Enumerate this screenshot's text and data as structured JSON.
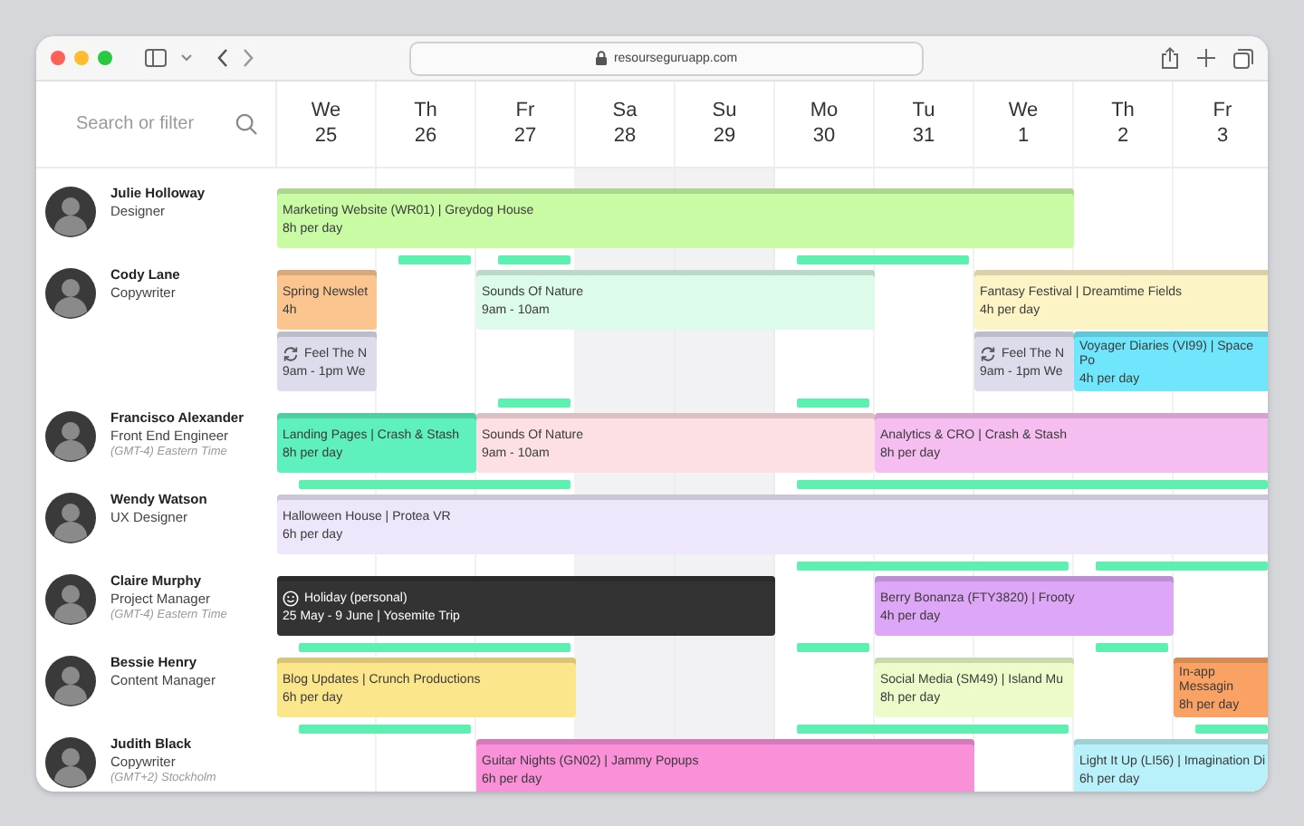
{
  "browser": {
    "url": "resourseguruapp.com"
  },
  "search": {
    "placeholder": "Search or filter"
  },
  "days": [
    {
      "weekday": "We",
      "date": "25",
      "weekend": false
    },
    {
      "weekday": "Th",
      "date": "26",
      "weekend": false
    },
    {
      "weekday": "Fr",
      "date": "27",
      "weekend": false
    },
    {
      "weekday": "Sa",
      "date": "28",
      "weekend": true
    },
    {
      "weekday": "Su",
      "date": "29",
      "weekend": true
    },
    {
      "weekday": "Mo",
      "date": "30",
      "weekend": false
    },
    {
      "weekday": "Tu",
      "date": "31",
      "weekend": false
    },
    {
      "weekday": "We",
      "date": "1",
      "weekend": false
    },
    {
      "weekday": "Th",
      "date": "2",
      "weekend": false
    },
    {
      "weekday": "Fr",
      "date": "3",
      "weekend": false
    }
  ],
  "people": [
    {
      "name": "Julie Holloway",
      "role": "Designer",
      "bookings": [
        {
          "kind": "project",
          "title": "Marketing Website (WR01) | Greydog House",
          "detail": "8h per day",
          "color": "#c9fba5"
        }
      ]
    },
    {
      "name": "Cody Lane",
      "role": "Copywriter",
      "bookings": [
        {
          "kind": "project",
          "title": "Spring Newslet",
          "detail": "4h",
          "color": "#fbc590"
        },
        {
          "kind": "project",
          "title": "Sounds Of Nature",
          "detail": "9am - 10am",
          "color": "#dcfbea"
        },
        {
          "kind": "project",
          "title": "Fantasy Festival | Dreamtime Fields",
          "detail": "4h per day",
          "color": "#fdf4c6"
        },
        {
          "kind": "recurring",
          "title": "Feel The N",
          "detail": "9am - 1pm We",
          "color": "#dcdcec"
        },
        {
          "kind": "recurring",
          "title": "Feel The N",
          "detail": "9am - 1pm We",
          "color": "#dcdcec"
        },
        {
          "kind": "project",
          "title": "Voyager Diaries (VI99) | Space Po",
          "detail": "4h per day",
          "color": "#6fe6fb"
        }
      ]
    },
    {
      "name": "Francisco Alexander",
      "role": "Front End Engineer",
      "timezone": "(GMT-4) Eastern Time",
      "bookings": [
        {
          "kind": "project",
          "title": "Landing Pages | Crash & Stash",
          "detail": "8h per day",
          "color": "#5ef0bd"
        },
        {
          "kind": "project",
          "title": "Sounds Of Nature",
          "detail": "9am - 10am",
          "color": "#fde0e3"
        },
        {
          "kind": "project",
          "title": "Analytics & CRO | Crash & Stash",
          "detail": "8h per day",
          "color": "#f6bdf1"
        }
      ]
    },
    {
      "name": "Wendy Watson",
      "role": "UX Designer",
      "bookings": [
        {
          "kind": "project",
          "title": "Halloween House | Protea VR",
          "detail": "6h per day",
          "color": "#eee6fb"
        }
      ]
    },
    {
      "name": "Claire Murphy",
      "role": "Project Manager",
      "timezone": "(GMT-4) Eastern Time",
      "bookings": [
        {
          "kind": "holiday",
          "title": "Holiday (personal)",
          "detail": "25 May - 9 June | Yosemite Trip",
          "color": "#333333"
        },
        {
          "kind": "project",
          "title": "Berry Bonanza (FTY3820) | Frooty",
          "detail": "4h per day",
          "color": "#dea6f6"
        }
      ]
    },
    {
      "name": "Bessie Henry",
      "role": "Content Manager",
      "bookings": [
        {
          "kind": "project",
          "title": "Blog Updates | Crunch Productions",
          "detail": "6h per day",
          "color": "#fce68c"
        },
        {
          "kind": "project",
          "title": "Social Media (SM49) | Island Mu",
          "detail": "8h per day",
          "color": "#edfbcb"
        },
        {
          "kind": "project",
          "title": "In-app Messagin",
          "detail": "8h per day",
          "color": "#f9a264"
        }
      ]
    },
    {
      "name": "Judith Black",
      "role": "Copywriter",
      "timezone": "(GMT+2) Stockholm",
      "bookings": [
        {
          "kind": "project",
          "title": "Guitar Nights (GN02) | Jammy Popups",
          "detail": "6h per day",
          "color": "#f990d8"
        },
        {
          "kind": "project",
          "title": "Light It Up (LI56) | Imagination Di",
          "detail": "6h per day",
          "color": "#b8f1f9"
        }
      ]
    }
  ]
}
